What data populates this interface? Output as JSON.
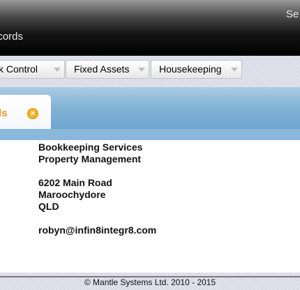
{
  "header": {
    "title": "ecords",
    "right_link": "Se"
  },
  "menu": {
    "items": [
      {
        "label": "ck Control"
      },
      {
        "label": "Fixed Assets"
      },
      {
        "label": "Housekeeping"
      }
    ]
  },
  "tab": {
    "label": "ls",
    "close_glyph": "×",
    "close_icon": "close-icon",
    "active_color": "#e69a2c"
  },
  "details": {
    "lines": [
      "Bookkeeping Services",
      "Property Management",
      "6202 Main Road",
      "Maroochydore",
      "QLD",
      "robyn@infin8integr8.com"
    ]
  },
  "footer": {
    "text": "© Mantle Systems Ltd. 2010 - 2015"
  }
}
